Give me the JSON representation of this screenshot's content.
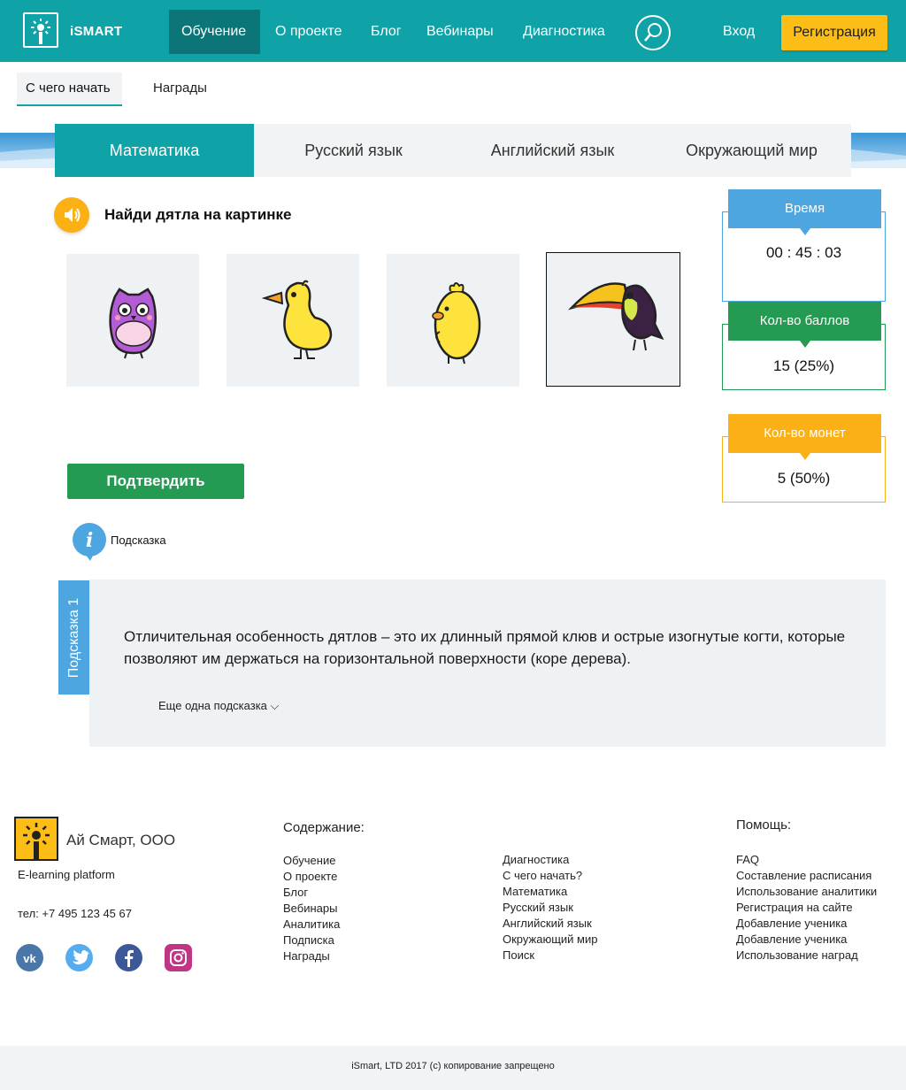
{
  "header": {
    "logo_text": "iSMART",
    "nav": [
      "Обучение",
      "О проекте",
      "Блог",
      "Вебинары",
      "Диагностика"
    ],
    "login": "Вход",
    "register": "Регистрация"
  },
  "subnav": [
    "С чего начать",
    "Награды"
  ],
  "subjects": [
    "Математика",
    "Русский язык",
    "Английский язык",
    "Окружающий мир"
  ],
  "question": {
    "text": "Найди дятла на картинке",
    "options": [
      "owl",
      "duck",
      "chick",
      "toucan"
    ],
    "confirm": "Подтвердить",
    "hint_label": "Подсказка"
  },
  "hint": {
    "tab_label": "Подсказка 1",
    "text": "Отличительная особенность дятлов – это их длинный прямой клюв и острые изогнутые когти, которые позволяют им держаться на горизонтальной поверхности (коре дерева).",
    "more": "Еще одна подсказка ⌵"
  },
  "stats": {
    "time": {
      "label": "Время",
      "value": "00 : 45 : 03",
      "color": "#4da6e0"
    },
    "points": {
      "label": "Кол-во баллов",
      "value": "15 (25%)",
      "color": "#249a52"
    },
    "coins": {
      "label": "Кол-во монет",
      "value": "5 (50%)",
      "color": "#fbb116"
    }
  },
  "footer": {
    "company": "Ай Смарт, ООО",
    "subtitle": "E-learning platform",
    "tel": "тел: +7 495 123 45 67",
    "social": [
      "vk-icon",
      "twitter-icon",
      "facebook-icon",
      "instagram-icon"
    ],
    "content_heading": "Содержание:",
    "content_col1": [
      "Обучение",
      "О проекте",
      "Блог",
      "Вебинары",
      "Аналитика",
      "Подписка",
      "Награды"
    ],
    "content_col2": [
      "Диагностика",
      "С чего начать?",
      "Математика",
      "Русский язык",
      "Английский язык",
      "Окружающий мир",
      "Поиск"
    ],
    "help_heading": "Помощь:",
    "help": [
      "FAQ",
      "Составление расписания",
      "Использование аналитики",
      "Регистрация на сайте",
      "Добавление ученика",
      "Добавление ученика",
      "Использование наград"
    ],
    "copyright": "iSmart, LTD 2017 (c) копирование запрещено"
  },
  "colors": {
    "teal": "#0fa3a8",
    "teal_dark": "#0b7577",
    "yellow": "#fbbd16",
    "green": "#249a52",
    "blue": "#4da6e0"
  }
}
